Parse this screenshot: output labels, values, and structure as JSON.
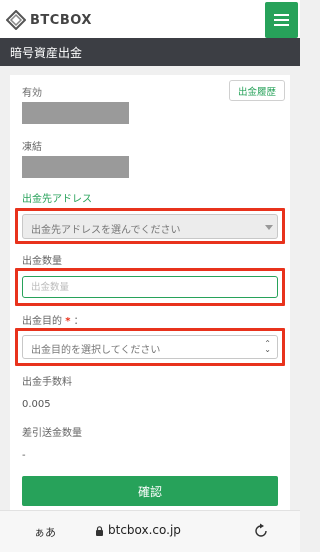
{
  "header": {
    "logo_text": "BTCBOX"
  },
  "page_title": "暗号資産出金",
  "history_button": "出金履歴",
  "fields": {
    "available_label": "有効",
    "frozen_label": "凍結",
    "address_label": "出金先アドレス",
    "address_select_value": "出金先アドレスを選んでください",
    "amount_label": "出金数量",
    "amount_placeholder": "出金数量",
    "purpose_label": "出金目的",
    "purpose_required": "*",
    "purpose_colon": "：",
    "purpose_select_value": "出金目的を選択してください",
    "fee_label": "出金手数料",
    "fee_value": "0.005",
    "net_label": "差引送金数量",
    "net_value": "-"
  },
  "confirm_button": "確認",
  "browser": {
    "aa": "ぁあ",
    "domain": "btcbox.co.jp"
  },
  "colors": {
    "accent": "#27a25a",
    "highlight": "#e8321c",
    "titlebar": "#3c3e44"
  }
}
